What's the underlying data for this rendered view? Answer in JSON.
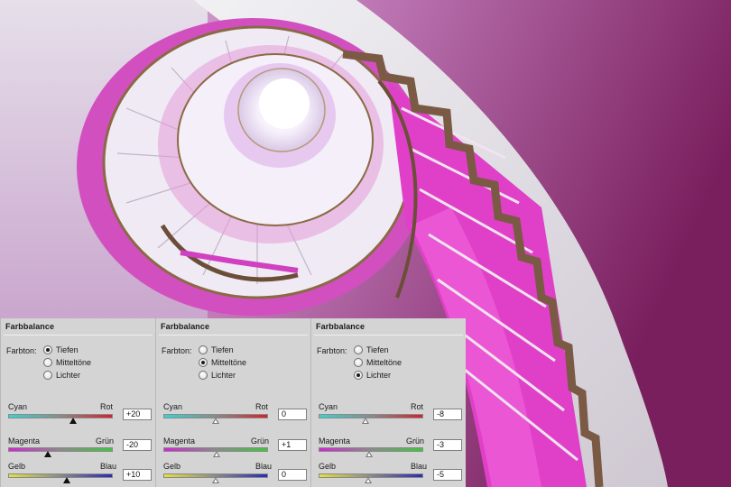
{
  "panels": [
    {
      "title": "Farbbalance",
      "tone_label": "Farbton:",
      "tones": [
        {
          "label": "Tiefen",
          "checked": true
        },
        {
          "label": "Mitteltöne",
          "checked": false
        },
        {
          "label": "Lichter",
          "checked": false
        }
      ],
      "sliders": [
        {
          "left": "Cyan",
          "right": "Rot",
          "value": "+20",
          "amount": 20
        },
        {
          "left": "Magenta",
          "right": "Grün",
          "value": "-20",
          "amount": -20
        },
        {
          "left": "Gelb",
          "right": "Blau",
          "value": "+10",
          "amount": 10
        }
      ]
    },
    {
      "title": "Farbbalance",
      "tone_label": "Farbton:",
      "tones": [
        {
          "label": "Tiefen",
          "checked": false
        },
        {
          "label": "Mitteltöne",
          "checked": true
        },
        {
          "label": "Lichter",
          "checked": false
        }
      ],
      "sliders": [
        {
          "left": "Cyan",
          "right": "Rot",
          "value": "0",
          "amount": 0
        },
        {
          "left": "Magenta",
          "right": "Grün",
          "value": "+1",
          "amount": 1
        },
        {
          "left": "Gelb",
          "right": "Blau",
          "value": "0",
          "amount": 0
        }
      ]
    },
    {
      "title": "Farbbalance",
      "tone_label": "Farbton:",
      "tones": [
        {
          "label": "Tiefen",
          "checked": false
        },
        {
          "label": "Mitteltöne",
          "checked": false
        },
        {
          "label": "Lichter",
          "checked": true
        }
      ],
      "sliders": [
        {
          "left": "Cyan",
          "right": "Rot",
          "value": "-8",
          "amount": -8
        },
        {
          "left": "Magenta",
          "right": "Grün",
          "value": "-3",
          "amount": -3
        },
        {
          "left": "Gelb",
          "right": "Blau",
          "value": "-5",
          "amount": -5
        }
      ]
    }
  ],
  "colors": {
    "cyan": "#34d6d2",
    "red": "#d8202a",
    "magenta": "#d425d4",
    "green": "#3cc83c",
    "yellow": "#e4e13a",
    "blue": "#2a2ab8",
    "stairs_pink": "#e040c8",
    "wall_purple": "#8c2a72"
  }
}
